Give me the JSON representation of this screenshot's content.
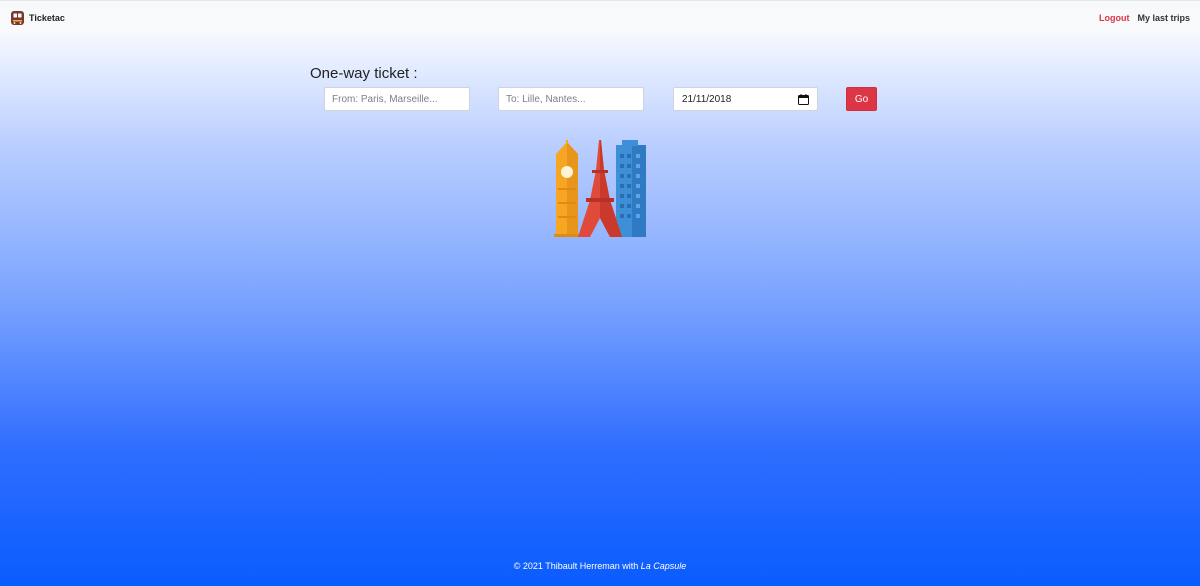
{
  "navbar": {
    "brand_name": "Ticketac",
    "brand_icon": "train-icon",
    "links": {
      "logout": "Logout",
      "last_trips": "My last trips"
    }
  },
  "search": {
    "title": "One-way ticket :",
    "from_placeholder": "From: Paris, Marseille...",
    "to_placeholder": "To: Lille, Nantes...",
    "date_value": "21/11/2018",
    "date_icon": "calendar-icon",
    "go_label": "Go"
  },
  "illustration": {
    "icon": "landmarks-illustration"
  },
  "footer": {
    "prefix": "© 2021 Thibault Herreman with ",
    "company": "La Capsule"
  },
  "colors": {
    "accent": "#dc3545",
    "gradient_top": "#eef4ff",
    "gradient_bottom": "#0a5cff"
  }
}
